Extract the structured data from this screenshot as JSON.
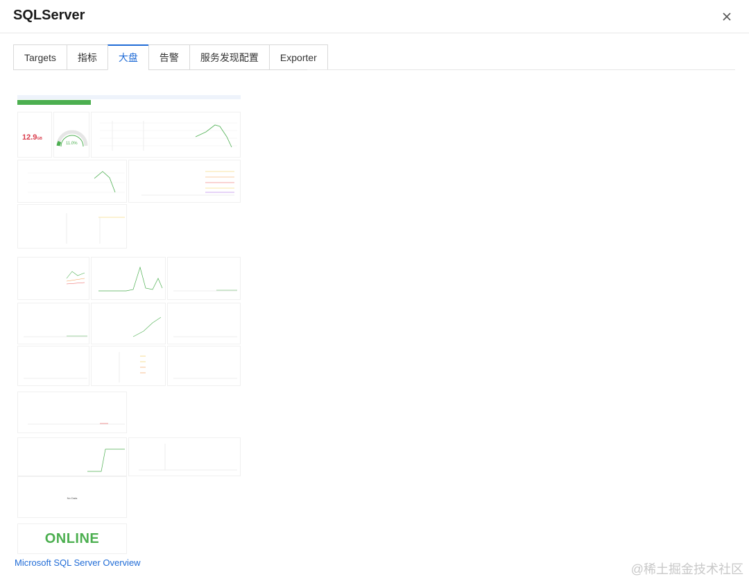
{
  "window": {
    "title": "SQLServer"
  },
  "tabs": [
    {
      "label": "Targets"
    },
    {
      "label": "指标"
    },
    {
      "label": "大盘"
    },
    {
      "label": "告警"
    },
    {
      "label": "服务发现配置"
    },
    {
      "label": "Exporter"
    }
  ],
  "active_tab": "大盘",
  "dashboard": {
    "memory_value": "12.9",
    "memory_unit": "GB",
    "gauge_value": "11.0%",
    "no_data": "No Data",
    "status": "ONLINE"
  },
  "footer": {
    "link": "Microsoft SQL Server Overview"
  },
  "watermark": "@稀土掘金技术社区",
  "colors": {
    "accent": "#1f6bd6",
    "green": "#4caf50",
    "red": "#d93a4a"
  }
}
